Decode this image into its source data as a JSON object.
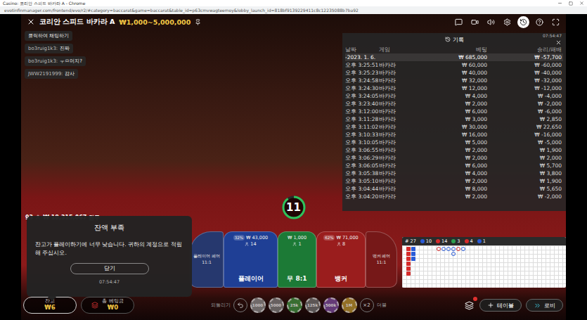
{
  "browser": {
    "title": "Casino: 코리안 스피드 바카라 A - Chrome",
    "url": "evotinfinmanager.com/frontend/evo/r2/#category=baccarat&game=baccarat&table_id=p63cmvwagteemoy&lobby_launch_id=818bf9139229411c8c12235088b7ba92"
  },
  "game": {
    "title": "코리안 스피드 바카라 A",
    "limits": "₩1,000~5,000,000"
  },
  "toolbar": [
    {
      "selected": false
    },
    {
      "selected": false
    },
    {
      "selected": false
    },
    {
      "selected": false
    },
    {
      "selected": true
    },
    {
      "selected": false
    },
    {
      "selected": false
    }
  ],
  "chat": {
    "placeholder": "클릭하여 채팅하기",
    "messages": [
      {
        "user": "bo3ruig1k3:",
        "text": "진짜"
      },
      {
        "user": "bo3ruig1k3:",
        "text": "ㅜㅁ머지?"
      },
      {
        "user": "JWW2191999:",
        "text": "감사"
      }
    ]
  },
  "history": {
    "title": "기록",
    "time": "07:54:47",
    "columns": [
      "날짜",
      "게임",
      "베팅",
      "승리/패배"
    ],
    "summary": {
      "date": "-2023. 1. 6.",
      "bet": "₩ 685,000",
      "result": "₩ -57,700"
    },
    "rows": [
      {
        "time": "오후 3:25:51",
        "game": "바카라",
        "bet": "₩ 60,000",
        "result": "₩ -60,000"
      },
      {
        "time": "오후 3:25:23",
        "game": "바카라",
        "bet": "₩ 40,000",
        "result": "₩ -40,000"
      },
      {
        "time": "오후 3:24:58",
        "game": "바카라",
        "bet": "₩ 32,000",
        "result": "₩ -32,000"
      },
      {
        "time": "오후 3:24:30",
        "game": "바카라",
        "bet": "₩ 12,000",
        "result": "₩ -12,000"
      },
      {
        "time": "오후 3:24:05",
        "game": "바카라",
        "bet": "₩ 4,000",
        "result": "₩ -4,000"
      },
      {
        "time": "오후 3:23:40",
        "game": "바카라",
        "bet": "₩ 2,000",
        "result": "₩ -2,000"
      },
      {
        "time": "오후 3:12:00",
        "game": "바카라",
        "bet": "₩ 6,000",
        "result": "₩ -6,000"
      },
      {
        "time": "오후 3:11:28",
        "game": "바카라",
        "bet": "₩ 3,000",
        "result": "₩ 2,850"
      },
      {
        "time": "오후 3:11:02",
        "game": "바카라",
        "bet": "₩ 30,000",
        "result": "₩ 22,650"
      },
      {
        "time": "오후 3:10:33",
        "game": "바카라",
        "bet": "₩ 16,000",
        "result": "₩ -16,000"
      },
      {
        "time": "오후 3:10:05",
        "game": "바카라",
        "bet": "₩ 5,000",
        "result": "₩ -5,000"
      },
      {
        "time": "오후 3:06:55",
        "game": "바카라",
        "bet": "₩ 2,000",
        "result": "₩ 1,900"
      },
      {
        "time": "오후 3:06:29",
        "game": "바카라",
        "bet": "₩ 2,000",
        "result": "₩ 2,000"
      },
      {
        "time": "오후 3:06:05",
        "game": "바카라",
        "bet": "₩ 6,000",
        "result": "₩ 5,700"
      },
      {
        "time": "오후 3:05:38",
        "game": "바카라",
        "bet": "₩ 4,000",
        "result": "₩ 3,800"
      },
      {
        "time": "오후 3:05:10",
        "game": "바카라",
        "bet": "₩ 2,000",
        "result": "₩ 1,900"
      },
      {
        "time": "오후 3:04:44",
        "game": "바카라",
        "bet": "₩ 8,000",
        "result": "₩ 5,650"
      },
      {
        "time": "오후 3:04:20",
        "game": "바카라",
        "bet": "₩ 2,000",
        "result": "₩ -2,000"
      }
    ]
  },
  "timer": {
    "value": "11",
    "level": 0.9
  },
  "table_stats": {
    "players": "93",
    "total": "₩ 18,315,067",
    "unit": "원두"
  },
  "bets": [
    {
      "kind": "pair",
      "label": "플레이어 페어",
      "payout": "11:1",
      "color": "#26386e"
    },
    {
      "kind": "main",
      "label": "플레이어",
      "percent": "32%",
      "amount": "₩ 43,000",
      "players": "14",
      "color": "#1f3f95"
    },
    {
      "kind": "main",
      "label": "무 8:1",
      "percent": "",
      "amount": "₩ 1,000",
      "players": "1",
      "color": "#1c7a36"
    },
    {
      "kind": "main",
      "label": "뱅커",
      "percent": "62%",
      "amount": "₩ 71,000",
      "players": "8",
      "color": "#9a1d1d"
    },
    {
      "kind": "pair",
      "label": "뱅커 페어",
      "payout": "11:1",
      "color": "#761818"
    }
  ],
  "roadmap": {
    "round": "# 27",
    "stats": [
      {
        "label": "10",
        "color": "#2a5bd7"
      },
      {
        "label": "14",
        "color": "#d62b2b"
      },
      {
        "label": "3",
        "color": "#2e9e4f"
      },
      {
        "label": "4",
        "color": "#d62b2b"
      },
      {
        "label": "1",
        "color": "#2a5bd7"
      }
    ],
    "bead_plate": [
      {
        "color": "#d62b2b",
        "count": 6
      },
      {
        "color": "#2a5bd7",
        "count": 3
      }
    ],
    "big_road": [
      {
        "color": "#d62b2b",
        "count": 1
      },
      {
        "color": "#2a5bd7",
        "count": 1
      },
      {
        "color": "#2a5bd7",
        "count": 1
      },
      {
        "color": "#2a5bd7",
        "count": 2
      },
      {
        "color": "#d62b2b",
        "count": 1
      },
      {
        "color": "#2a5bd7",
        "count": 1
      }
    ]
  },
  "dialog": {
    "title": "잔액 부족",
    "message": "잔고가 플레이하기에 너무 낮습니다. 귀하의 계정으로 적립해 주십시오.",
    "button": "닫기",
    "time": "07:54:47"
  },
  "balance": {
    "label": "잔고",
    "value": "₩6"
  },
  "total_bet": {
    "label": "총 베팅금",
    "value": "₩0"
  },
  "chip_tray": {
    "undo": "되돌리기",
    "chips": [
      {
        "value": "1000",
        "color": "#8a8a8a"
      },
      {
        "value": "5000",
        "color": "#7d7d7d"
      },
      {
        "value": "25k",
        "color": "#3f8f3f"
      },
      {
        "value": "125k",
        "color": "#6f6f6f"
      },
      {
        "value": "500k",
        "color": "#7a4a9c"
      },
      {
        "value": "1M",
        "color": "#b8912f"
      }
    ],
    "multiplier": "×2",
    "double": "더블"
  },
  "nav": {
    "cart_badge": true,
    "table": "테이블",
    "lobby": "로비"
  }
}
